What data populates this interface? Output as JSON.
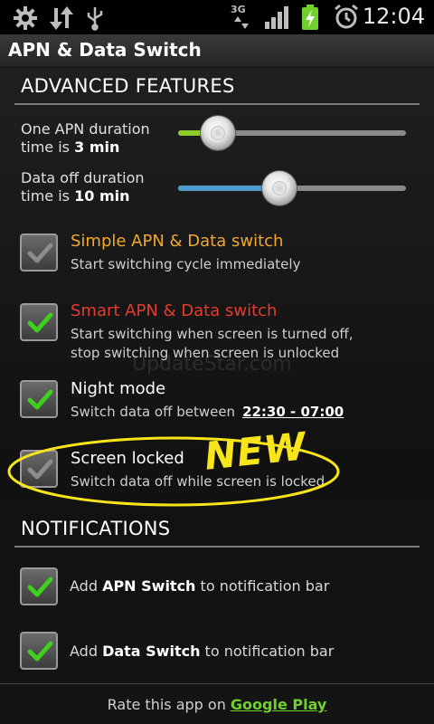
{
  "status_bar": {
    "network_type": "3G",
    "time": "12:04",
    "icons": [
      "settings-icon",
      "data-transfer-icon",
      "usb-icon",
      "signal-icon",
      "battery-charging-icon",
      "alarm-icon"
    ]
  },
  "app": {
    "title": "APN & Data Switch"
  },
  "advanced": {
    "header": "ADVANCED FEATURES",
    "sliders": [
      {
        "label_line1": "One APN duration",
        "label_prefix": "time is ",
        "value": "3 min",
        "fraction": 0.16,
        "fill_color": "#8fcb2b"
      },
      {
        "label_line1": "Data off duration",
        "label_prefix": "time is ",
        "value": "10 min",
        "fraction": 0.45,
        "fill_color": "#4f9bd0"
      }
    ],
    "items": [
      {
        "title": "Simple APN & Data switch",
        "subtitle": "Start switching cycle immediately",
        "checked": false,
        "title_color": "#f0a830"
      },
      {
        "title": "Smart APN & Data switch",
        "subtitle_1": "Start switching when screen is turned off,",
        "subtitle_2": "stop switching when screen is unlocked",
        "checked": true,
        "title_color": "#e53b2e"
      },
      {
        "title": "Night mode",
        "subtitle": "Switch data off between",
        "time_range": "22:30 - 07:00",
        "checked": true
      },
      {
        "title": "Screen locked",
        "subtitle": "Switch data off while screen is locked",
        "checked": false,
        "badge": "NEW"
      }
    ]
  },
  "notifications": {
    "header": "NOTIFICATIONS",
    "items": [
      {
        "prefix": "Add ",
        "bold": "APN Switch",
        "suffix": " to notification bar",
        "checked": true
      },
      {
        "prefix": "Add ",
        "bold": "Data Switch",
        "suffix": " to notification bar",
        "checked": true
      }
    ]
  },
  "footer": {
    "text": "Rate this app on ",
    "link": "Google Play"
  },
  "watermark": "UpdateStar.com",
  "colors": {
    "check_green": "#3fd01e",
    "badge_yellow": "#f7e51a"
  }
}
